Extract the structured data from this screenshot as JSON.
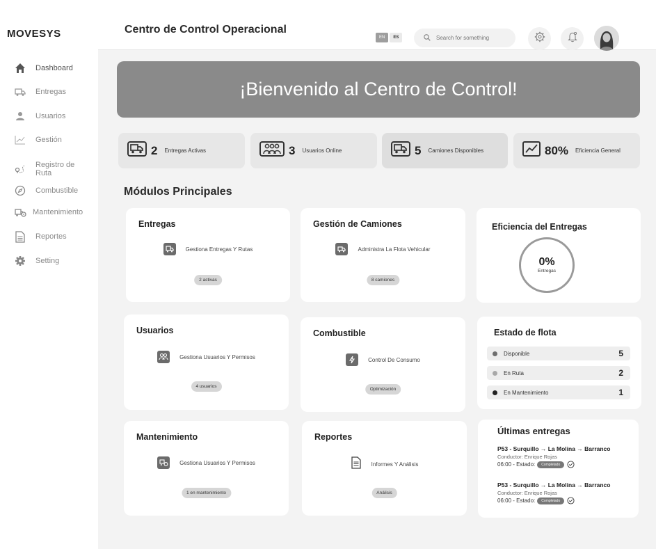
{
  "sidebar": {
    "logo": "MOVESYS",
    "items": [
      {
        "label": "Dashboard",
        "icon": "home-icon"
      },
      {
        "label": "Entregas",
        "icon": "truck-icon"
      },
      {
        "label": "Usuarios",
        "icon": "user-icon"
      },
      {
        "label": "Gestión",
        "icon": "chart-line-icon"
      },
      {
        "label": "Registro de Ruta",
        "icon": "route-icon"
      },
      {
        "label": "Combustible",
        "icon": "compass-icon"
      },
      {
        "label": "Mantenimiento",
        "icon": "truck-gear-icon"
      },
      {
        "label": "Reportes",
        "icon": "document-icon"
      },
      {
        "label": "Setting",
        "icon": "gear-icon"
      }
    ]
  },
  "header": {
    "title": "Centro de Control Operacional",
    "lang_en": "EN",
    "lang_es": "ES",
    "search_placeholder": "Search for something"
  },
  "banner": {
    "text": "¡Bienvenido al Centro de Control!"
  },
  "stats": [
    {
      "value": "2",
      "label": "Entregas Activas",
      "icon": "truck-icon"
    },
    {
      "value": "3",
      "label": "Usuarios Online",
      "icon": "users-group-icon"
    },
    {
      "value": "5",
      "label": "Camiones Disponibles",
      "icon": "truck-icon"
    },
    {
      "value": "80%",
      "label": "Eficiencia General",
      "icon": "chart-line-icon"
    }
  ],
  "section_title": "Módulos Principales",
  "modules": {
    "entregas": {
      "title": "Entregas",
      "desc": "Gestiona Entregas Y Rutas",
      "pill": "2 activas"
    },
    "camiones": {
      "title": "Gestión de Camiones",
      "desc": "Administra La Flota Vehicular",
      "pill": "8 camiones"
    },
    "usuarios": {
      "title": "Usuarios",
      "desc": "Gestiona Usuarios Y Permisos",
      "pill": "4 usuarios"
    },
    "combustible": {
      "title": "Combustible",
      "desc": "Control De Consumo",
      "pill": "Optimización"
    },
    "mantenimiento": {
      "title": "Mantenimiento",
      "desc": "Gestiona Usuarios Y Permisos",
      "pill": "1 en mantenimiento"
    },
    "reportes": {
      "title": "Reportes",
      "desc": "Informes Y Análisis",
      "pill": "Análisis"
    }
  },
  "efficiency": {
    "title": "Eficiencia del Entregas",
    "value": "0%",
    "label": "Entregas",
    "progress_fraction": 0
  },
  "fleet": {
    "title": "Estado de flota",
    "rows": [
      {
        "label": "Disponible",
        "count": "5",
        "color": "#6e6e6e"
      },
      {
        "label": "En Ruta",
        "count": "2",
        "color": "#a8a8a8"
      },
      {
        "label": "En Mantenimiento",
        "count": "1",
        "color": "#222222"
      }
    ]
  },
  "deliveries": {
    "title": "Últimas entregas",
    "items": [
      {
        "route": "P53 - Surquillo → La Molina → Barranco",
        "driver": "Conductor: Enrique Rojas",
        "status_prefix": "06:00 - Estado:",
        "status": "Completado"
      },
      {
        "route": "P53 - Surquillo → La Molina → Barranco",
        "driver": "Conductor: Enrique Rojas",
        "status_prefix": "06:00 - Estado:",
        "status": "Completado"
      }
    ]
  }
}
